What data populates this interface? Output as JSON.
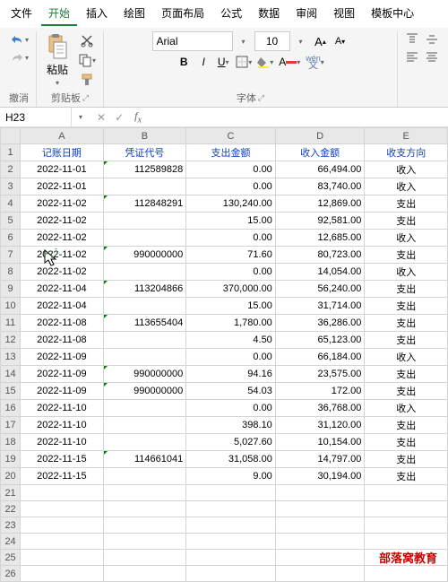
{
  "menu": {
    "file": "文件",
    "start": "开始",
    "insert": "插入",
    "draw": "绘图",
    "layout": "页面布局",
    "formula": "公式",
    "data": "数据",
    "review": "审阅",
    "view": "视图",
    "template": "模板中心"
  },
  "groups": {
    "undo": "撤消",
    "clipboard": "剪贴板",
    "font": "字体",
    "paste": "粘贴"
  },
  "font": {
    "name": "Arial",
    "size": "10"
  },
  "cellref": "H23",
  "colHeads": [
    "A",
    "B",
    "C",
    "D",
    "E"
  ],
  "headers": [
    "记账日期",
    "凭证代号",
    "支出金额",
    "收入金额",
    "收支方向"
  ],
  "rows": [
    {
      "d": "2022-11-01",
      "v": "112589828",
      "o": "0.00",
      "i": "66,494.00",
      "t": "收入"
    },
    {
      "d": "2022-11-01",
      "v": "",
      "o": "0.00",
      "i": "83,740.00",
      "t": "收入"
    },
    {
      "d": "2022-11-02",
      "v": "112848291",
      "o": "130,240.00",
      "i": "12,869.00",
      "t": "支出"
    },
    {
      "d": "2022-11-02",
      "v": "",
      "o": "15.00",
      "i": "92,581.00",
      "t": "支出"
    },
    {
      "d": "2022-11-02",
      "v": "",
      "o": "0.00",
      "i": "12,685.00",
      "t": "收入"
    },
    {
      "d": "2022-11-02",
      "v": "990000000",
      "o": "71.60",
      "i": "80,723.00",
      "t": "支出"
    },
    {
      "d": "2022-11-02",
      "v": "",
      "o": "0.00",
      "i": "14,054.00",
      "t": "收入"
    },
    {
      "d": "2022-11-04",
      "v": "113204866",
      "o": "370,000.00",
      "i": "56,240.00",
      "t": "支出"
    },
    {
      "d": "2022-11-04",
      "v": "",
      "o": "15.00",
      "i": "31,714.00",
      "t": "支出"
    },
    {
      "d": "2022-11-08",
      "v": "113655404",
      "o": "1,780.00",
      "i": "36,286.00",
      "t": "支出"
    },
    {
      "d": "2022-11-08",
      "v": "",
      "o": "4.50",
      "i": "65,123.00",
      "t": "支出"
    },
    {
      "d": "2022-11-09",
      "v": "",
      "o": "0.00",
      "i": "66,184.00",
      "t": "收入"
    },
    {
      "d": "2022-11-09",
      "v": "990000000",
      "o": "94.16",
      "i": "23,575.00",
      "t": "支出"
    },
    {
      "d": "2022-11-09",
      "v": "990000000",
      "o": "54.03",
      "i": "172.00",
      "t": "支出"
    },
    {
      "d": "2022-11-10",
      "v": "",
      "o": "0.00",
      "i": "36,768.00",
      "t": "收入"
    },
    {
      "d": "2022-11-10",
      "v": "",
      "o": "398.10",
      "i": "31,120.00",
      "t": "支出"
    },
    {
      "d": "2022-11-10",
      "v": "",
      "o": "5,027.60",
      "i": "10,154.00",
      "t": "支出"
    },
    {
      "d": "2022-11-15",
      "v": "114661041",
      "o": "31,058.00",
      "i": "14,797.00",
      "t": "支出"
    },
    {
      "d": "2022-11-15",
      "v": "",
      "o": "9.00",
      "i": "30,194.00",
      "t": "支出"
    }
  ],
  "emptyRows": [
    21,
    22,
    23,
    24,
    25,
    26
  ],
  "watermark": "部落窝教育"
}
